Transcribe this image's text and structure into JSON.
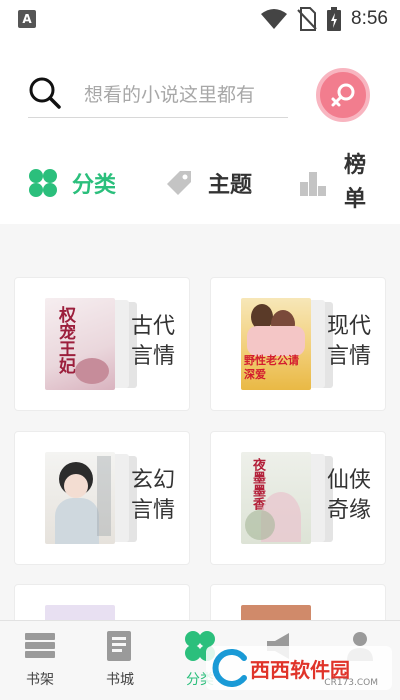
{
  "status_bar": {
    "notification_letter": "A",
    "time": "8:56"
  },
  "search": {
    "placeholder": "想看的小说这里都有"
  },
  "tabs": [
    {
      "label": "分类",
      "active": true
    },
    {
      "label": "主题",
      "active": false
    },
    {
      "label": "榜单",
      "active": false
    }
  ],
  "categories": [
    {
      "label": "古代言情",
      "cover_title": "权宠王妃"
    },
    {
      "label": "现代言情",
      "cover_title": "野性老公请深爱"
    },
    {
      "label": "玄幻言情",
      "cover_title": ""
    },
    {
      "label": "仙侠奇缘",
      "cover_title": "夜墨墨香"
    }
  ],
  "bottom_nav": [
    {
      "label": "书架",
      "active": false
    },
    {
      "label": "书城",
      "active": false
    },
    {
      "label": "分类",
      "active": true
    },
    {
      "label": "",
      "active": false
    },
    {
      "label": "",
      "active": false
    }
  ],
  "watermark": {
    "text": "西西软件园",
    "sub": "CR173.COM"
  },
  "colors": {
    "accent": "#2bbf7c",
    "pink": "#f27d8e"
  }
}
